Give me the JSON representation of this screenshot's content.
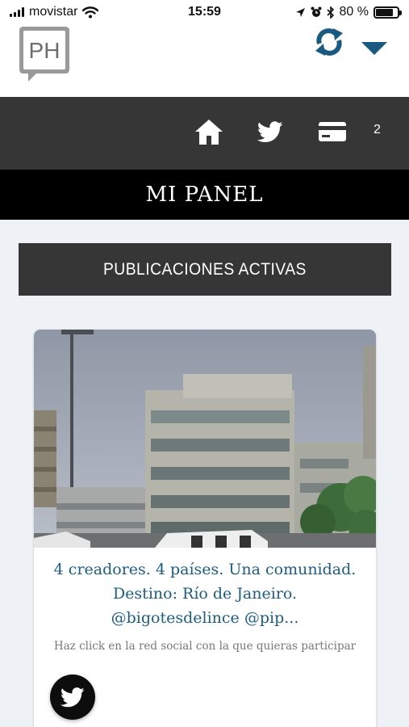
{
  "status_bar": {
    "carrier": "movistar",
    "time": "15:59",
    "battery_percent": "80 %",
    "battery_level": 0.8
  },
  "header": {
    "logo_text": "PH",
    "refresh_icon": "refresh-icon",
    "dropdown_icon": "chevron-down-icon"
  },
  "nav": {
    "items": [
      {
        "icon": "home-icon"
      },
      {
        "icon": "twitter-icon"
      },
      {
        "icon": "credit-card-icon"
      }
    ],
    "count": "2"
  },
  "panel": {
    "title": "MI PANEL"
  },
  "section": {
    "title": "PUBLICACIONES ACTIVAS"
  },
  "card": {
    "title_lines": [
      "4 creadores. 4 países. Una comunidad.",
      "Destino: Río de Janeiro.",
      "@bigotesdelince @pip..."
    ],
    "hint": "Haz click en la red social con la que quieras participar",
    "social_icon": "twitter-icon"
  },
  "colors": {
    "dark_bar": "#363636",
    "black_bar": "#000000",
    "accent": "#1c5d83",
    "page_bg": "#eef1f5"
  }
}
